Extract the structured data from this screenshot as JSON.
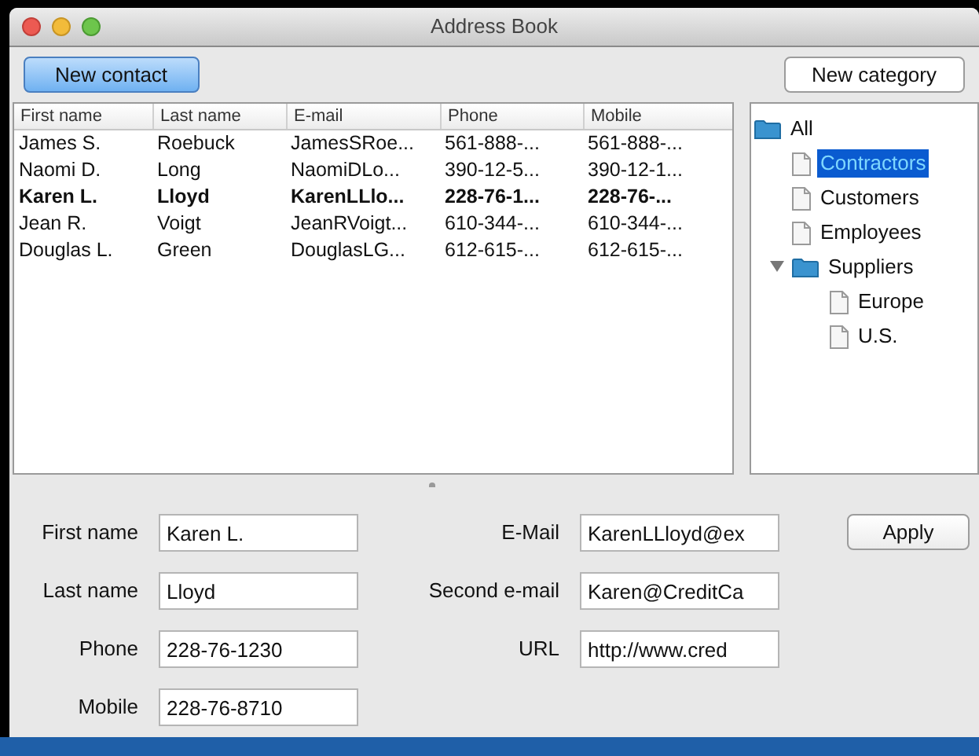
{
  "window": {
    "title": "Address Book"
  },
  "toolbar": {
    "new_contact": "New contact",
    "new_category": "New category"
  },
  "table": {
    "columns": [
      "First name",
      "Last name",
      "E-mail",
      "Phone",
      "Mobile"
    ],
    "rows": [
      {
        "cells": [
          "James S.",
          "Roebuck",
          "JamesSRoe...",
          "561-888-...",
          "561-888-..."
        ],
        "bold": false
      },
      {
        "cells": [
          "Naomi D.",
          "Long",
          "NaomiDLo...",
          "390-12-5...",
          "390-12-1..."
        ],
        "bold": false
      },
      {
        "cells": [
          "Karen L.",
          "Lloyd",
          "KarenLLlo...",
          "228-76-1...",
          "228-76-..."
        ],
        "bold": true
      },
      {
        "cells": [
          "Jean R.",
          "Voigt",
          "JeanRVoigt...",
          "610-344-...",
          "610-344-..."
        ],
        "bold": false
      },
      {
        "cells": [
          "Douglas L.",
          "Green",
          "DouglasLG...",
          "612-615-...",
          "612-615-..."
        ],
        "bold": false
      }
    ]
  },
  "tree": [
    {
      "label": "All",
      "kind": "folder",
      "selected": false,
      "children": [
        {
          "label": "Contractors",
          "kind": "file",
          "selected": true
        },
        {
          "label": "Customers",
          "kind": "file",
          "selected": false
        },
        {
          "label": "Employees",
          "kind": "file",
          "selected": false
        },
        {
          "label": "Suppliers",
          "kind": "folder",
          "selected": false,
          "expanded": true,
          "children": [
            {
              "label": "Europe",
              "kind": "file",
              "selected": false
            },
            {
              "label": "U.S.",
              "kind": "file",
              "selected": false
            }
          ]
        }
      ]
    }
  ],
  "form": {
    "left": [
      {
        "label": "First name",
        "value": "Karen L."
      },
      {
        "label": "Last name",
        "value": "Lloyd"
      },
      {
        "label": "Phone",
        "value": "228-76-1230"
      },
      {
        "label": "Mobile",
        "value": "228-76-8710"
      }
    ],
    "right": [
      {
        "label": "E-Mail",
        "value": "KarenLLloyd@ex"
      },
      {
        "label": "Second e-mail",
        "value": "Karen@CreditCa"
      },
      {
        "label": "URL",
        "value": "http://www.cred"
      }
    ],
    "apply": "Apply"
  }
}
